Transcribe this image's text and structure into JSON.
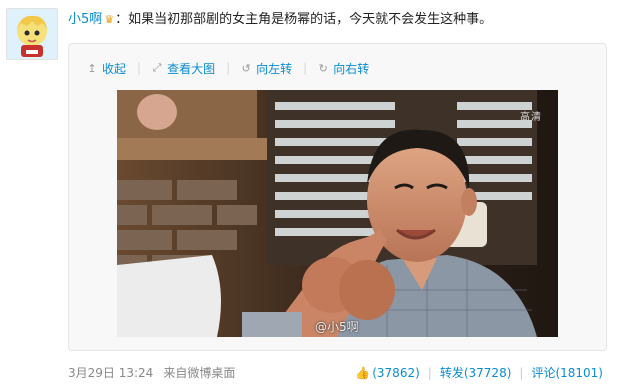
{
  "user": {
    "name": "小5啊",
    "avatar_icon": "cartoon-avatar-icon",
    "badge_icon": "crown-icon"
  },
  "post": {
    "text": "：如果当初那部剧的女主角是杨幂的话，今天就不会发生这种事。"
  },
  "media_toolbar": {
    "collapse": {
      "icon": "↥",
      "label": "收起"
    },
    "view_large": {
      "icon": "⤢",
      "label": "查看大图"
    },
    "rotate_left": {
      "icon": "↺",
      "label": "向左转"
    },
    "rotate_right": {
      "icon": "↻",
      "label": "向右转"
    }
  },
  "image": {
    "hd_mark": "高清",
    "watermark": "@小5啊"
  },
  "footer": {
    "date": "3月29日 13:24",
    "source": "来自微博桌面",
    "like_count": "(37862)",
    "repost_label": "转发",
    "repost_count": "(37728)",
    "comment_label": "评论",
    "comment_count": "(18101)"
  },
  "colors": {
    "link": "#0a8cd2",
    "meta": "#888888",
    "border": "#e6e6e6"
  }
}
